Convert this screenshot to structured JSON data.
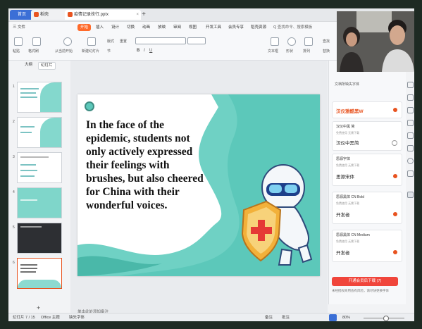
{
  "titlebar": {
    "home_tab": "首页",
    "wps_tab": "稻壳",
    "doc_tab": "疫情记录技行.pptx",
    "add_tab": "+"
  },
  "menubar": {
    "items": [
      "三 文件",
      "开始",
      "插入",
      "设计",
      "切换",
      "动画",
      "放映",
      "审阅",
      "视图",
      "开发工具",
      "会员专享",
      "稻壳资源",
      "Q 查找命令、搜索模板"
    ],
    "active_index": 1
  },
  "ribbon": {
    "labels": [
      "粘贴",
      "格式刷",
      "从当前开始",
      "新建幻灯片",
      "版式",
      "节",
      "重置",
      "文本框",
      "形状",
      "排列",
      "查找",
      "替换"
    ]
  },
  "left_panel": {
    "tabs": [
      "大纲",
      "幻灯片"
    ],
    "active_tab": 1,
    "slide_numbers": [
      "1",
      "2",
      "3",
      "4",
      "5",
      "6"
    ],
    "selected_slide": 6,
    "add_slide": "+"
  },
  "slide": {
    "text": "In the face of the epidemic, students not only actively expressed their feelings with brushes, but also cheered for China with their wonderful voices."
  },
  "notes": {
    "placeholder": "单击此处添加备注"
  },
  "right_panel": {
    "title": "文档所缺失字体",
    "header_font": "汉仪雅酷黑W",
    "fonts": [
      {
        "name": "汉仪中黑 简",
        "sub": "免费使用 无需下载",
        "preview": "汉仪中黑简"
      },
      {
        "name": "思源字体",
        "sub": "免费使用 无需下载",
        "preview": "思源宋体"
      },
      {
        "name": "思源黑体 CN Bold",
        "sub": "免费使用 无需下载",
        "preview": "开发者"
      },
      {
        "name": "思源黑体 CN Medium",
        "sub": "免费使用 无需下载",
        "preview": "开发者"
      }
    ],
    "download_button": "开通会员后下载 (7)",
    "footer": "未经授权商用会有风险，请尽快更换字体"
  },
  "statusbar": {
    "slide_info": "幻灯片 7 / 15",
    "theme": "Office 主题",
    "font_missing": "缺失字体",
    "zoom": "80%",
    "notes_btn": "备注",
    "comment_btn": "批注"
  },
  "colors": {
    "accent": "#ff6a2a",
    "teal": "#5cc8ba",
    "download": "#f0453b"
  }
}
